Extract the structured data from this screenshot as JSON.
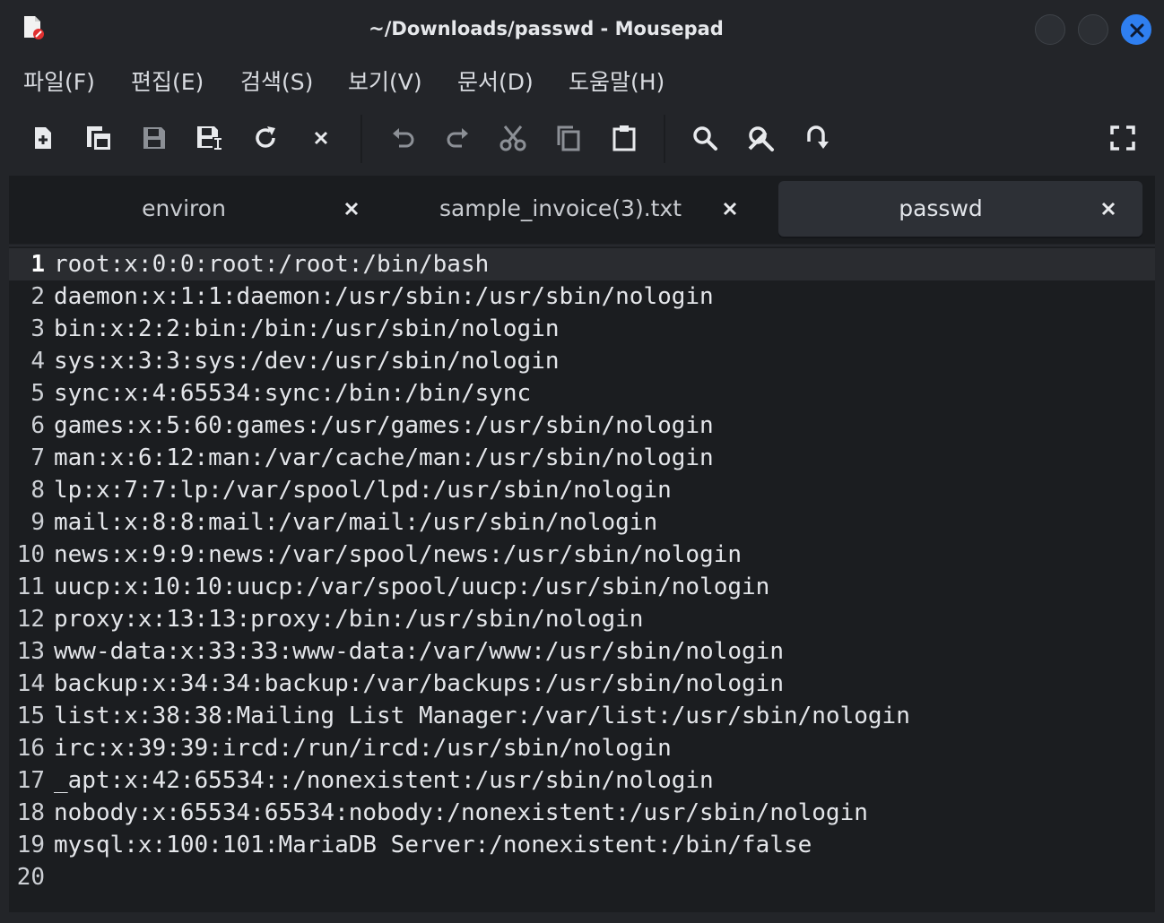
{
  "window": {
    "title": "~/Downloads/passwd - Mousepad"
  },
  "menu": [
    {
      "label": "파일(F)"
    },
    {
      "label": "편집(E)"
    },
    {
      "label": "검색(S)"
    },
    {
      "label": "보기(V)"
    },
    {
      "label": "문서(D)"
    },
    {
      "label": "도움말(H)"
    }
  ],
  "toolbar": {
    "icons": [
      "new-document-icon",
      "new-window-icon",
      "save-icon",
      "save-as-icon",
      "reload-icon",
      "close-icon",
      "undo-icon",
      "redo-icon",
      "cut-icon",
      "copy-icon",
      "paste-icon",
      "search-icon",
      "find-replace-icon",
      "go-to-line-icon",
      "fullscreen-icon"
    ]
  },
  "tabs": [
    {
      "label": "environ",
      "active": false
    },
    {
      "label": "sample_invoice(3).txt",
      "active": false
    },
    {
      "label": "passwd",
      "active": true
    }
  ],
  "editor": {
    "current_line": 1,
    "lines": [
      {
        "n": "1",
        "text": "root:x:0:0:root:/root:/bin/bash"
      },
      {
        "n": "2",
        "text": "daemon:x:1:1:daemon:/usr/sbin:/usr/sbin/nologin"
      },
      {
        "n": "3",
        "text": "bin:x:2:2:bin:/bin:/usr/sbin/nologin"
      },
      {
        "n": "4",
        "text": "sys:x:3:3:sys:/dev:/usr/sbin/nologin"
      },
      {
        "n": "5",
        "text": "sync:x:4:65534:sync:/bin:/bin/sync"
      },
      {
        "n": "6",
        "text": "games:x:5:60:games:/usr/games:/usr/sbin/nologin"
      },
      {
        "n": "7",
        "text": "man:x:6:12:man:/var/cache/man:/usr/sbin/nologin"
      },
      {
        "n": "8",
        "text": "lp:x:7:7:lp:/var/spool/lpd:/usr/sbin/nologin"
      },
      {
        "n": "9",
        "text": "mail:x:8:8:mail:/var/mail:/usr/sbin/nologin"
      },
      {
        "n": "10",
        "text": "news:x:9:9:news:/var/spool/news:/usr/sbin/nologin"
      },
      {
        "n": "11",
        "text": "uucp:x:10:10:uucp:/var/spool/uucp:/usr/sbin/nologin"
      },
      {
        "n": "12",
        "text": "proxy:x:13:13:proxy:/bin:/usr/sbin/nologin"
      },
      {
        "n": "13",
        "text": "www-data:x:33:33:www-data:/var/www:/usr/sbin/nologin"
      },
      {
        "n": "14",
        "text": "backup:x:34:34:backup:/var/backups:/usr/sbin/nologin"
      },
      {
        "n": "15",
        "text": "list:x:38:38:Mailing List Manager:/var/list:/usr/sbin/nologin"
      },
      {
        "n": "16",
        "text": "irc:x:39:39:ircd:/run/ircd:/usr/sbin/nologin"
      },
      {
        "n": "17",
        "text": "_apt:x:42:65534::/nonexistent:/usr/sbin/nologin"
      },
      {
        "n": "18",
        "text": "nobody:x:65534:65534:nobody:/nonexistent:/usr/sbin/nologin"
      },
      {
        "n": "19",
        "text": "mysql:x:100:101:MariaDB Server:/nonexistent:/bin/false"
      },
      {
        "n": "20",
        "text": ""
      }
    ]
  },
  "colors": {
    "accent": "#2f7ff0",
    "editor_bg": "#1b1d20",
    "current_line_bg": "#2a2c30"
  }
}
